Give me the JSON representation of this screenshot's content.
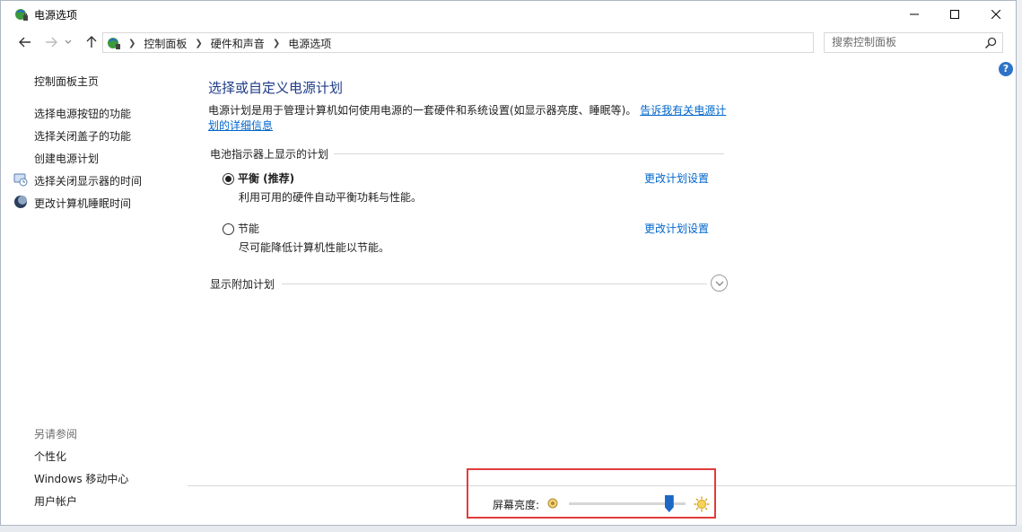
{
  "window": {
    "title": "电源选项",
    "buttons": {
      "minimize": "minimize",
      "maximize": "maximize",
      "close": "close"
    }
  },
  "address": {
    "crumbs": [
      "控制面板",
      "硬件和声音",
      "电源选项"
    ],
    "search_placeholder": "搜索控制面板"
  },
  "sidebar": {
    "home": "控制面板主页",
    "links": [
      "选择电源按钮的功能",
      "选择关闭盖子的功能",
      "创建电源计划",
      "选择关闭显示器的时间",
      "更改计算机睡眠时间"
    ],
    "see_also_title": "另请参阅",
    "see_also": [
      "个性化",
      "Windows 移动中心",
      "用户帐户"
    ]
  },
  "main": {
    "title": "选择或自定义电源计划",
    "description": "电源计划是用于管理计算机如何使用电源的一套硬件和系统设置(如显示器亮度、睡眠等)。",
    "description_link": "告诉我有关电源计划的详细信息",
    "group_title": "电池指示器上显示的计划",
    "plans": [
      {
        "name": "平衡 (推荐)",
        "description": "利用可用的硬件自动平衡功耗与性能。",
        "link": "更改计划设置",
        "selected": true
      },
      {
        "name": "节能",
        "description": "尽可能降低计算机性能以节能。",
        "link": "更改计划设置",
        "selected": false
      }
    ],
    "more_plans": "显示附加计划"
  },
  "brightness": {
    "label": "屏幕亮度:",
    "value_fraction": 0.86
  },
  "colors": {
    "link": "#0066cc",
    "title": "#1e3c87",
    "highlight": "#e03c3c",
    "slider": "#1b69c4"
  }
}
